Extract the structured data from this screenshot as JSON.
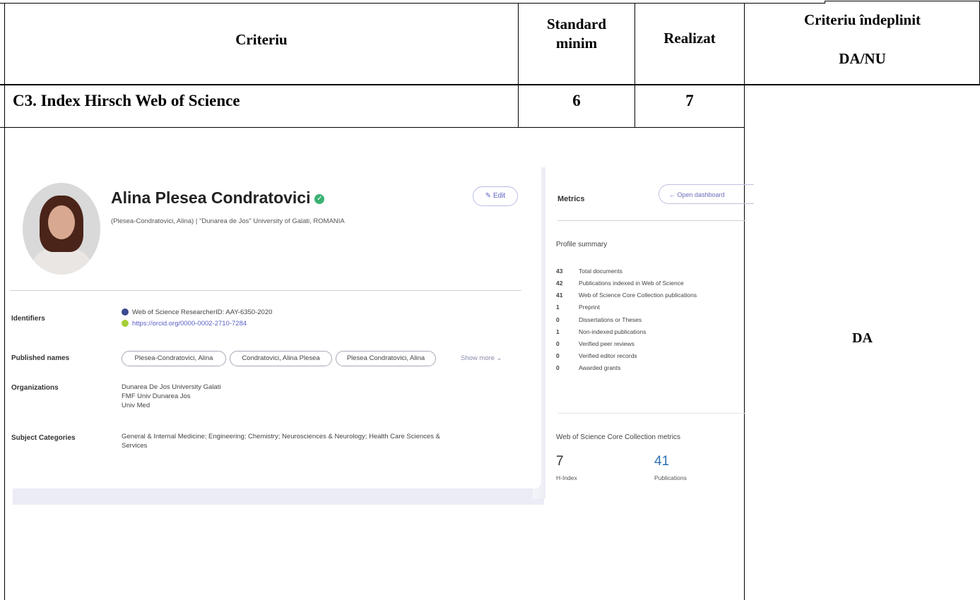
{
  "table": {
    "headers": {
      "criteriu": "Criteriu",
      "standard_line1": "Standard",
      "standard_line2": "minim",
      "realizat": "Realizat",
      "indeplinit_line1": "Criteriu îndeplinit",
      "indeplinit_line2": "DA/NU"
    },
    "row": {
      "criteriu": "C3. Index Hirsch Web of Science",
      "standard": "6",
      "realizat": "7",
      "indeplinit": "DA"
    }
  },
  "profile": {
    "name": "Alina Plesea Condratovici",
    "subline": "(Plesea-Condratovici, Alina) | \"Dunarea de Jos\" University of Galati, ROMANIA",
    "edit_label": "✎ Edit",
    "identifiers_label": "Identifiers",
    "researcher_id": "Web of Science ResearcherID: AAY-6350-2020",
    "orcid": "https://orcid.org/0000-0002-2710-7284",
    "published_names_label": "Published names",
    "names": [
      "Plesea-Condratovici, Alina",
      "Condratovici, Alina Plesea",
      "Plesea Condratovici, Alina"
    ],
    "show_more": "Show more ⌄",
    "organizations_label": "Organizations",
    "organizations": [
      "Dunarea De Jos University Galati",
      "FMF Univ Dunarea Jos",
      "Univ Med"
    ],
    "subject_label": "Subject Categories",
    "subjects_line1": "General & Internal Medicine;  Engineering;  Chemistry;  Neurosciences & Neurology;  Health Care Sciences &",
    "subjects_line2": "Services"
  },
  "metrics": {
    "title": "Metrics",
    "dashboard_button": "← Open dashboard",
    "profile_summary": "Profile summary",
    "rows": [
      {
        "n": "43",
        "label": "Total documents"
      },
      {
        "n": "42",
        "label": "Publications indexed in Web of Science"
      },
      {
        "n": "41",
        "label": "Web of Science Core Collection publications"
      },
      {
        "n": "1",
        "label": "Preprint"
      },
      {
        "n": "0",
        "label": "Dissertations or Theses"
      },
      {
        "n": "1",
        "label": "Non-indexed publications"
      },
      {
        "n": "0",
        "label": "Verified peer reviews"
      },
      {
        "n": "0",
        "label": "Verified editor records"
      },
      {
        "n": "0",
        "label": "Awarded grants"
      }
    ],
    "core_title": "Web of Science Core Collection metrics",
    "h_index_value": "7",
    "h_index_label": "H-Index",
    "publications_value": "41",
    "publications_label": "Publications"
  }
}
